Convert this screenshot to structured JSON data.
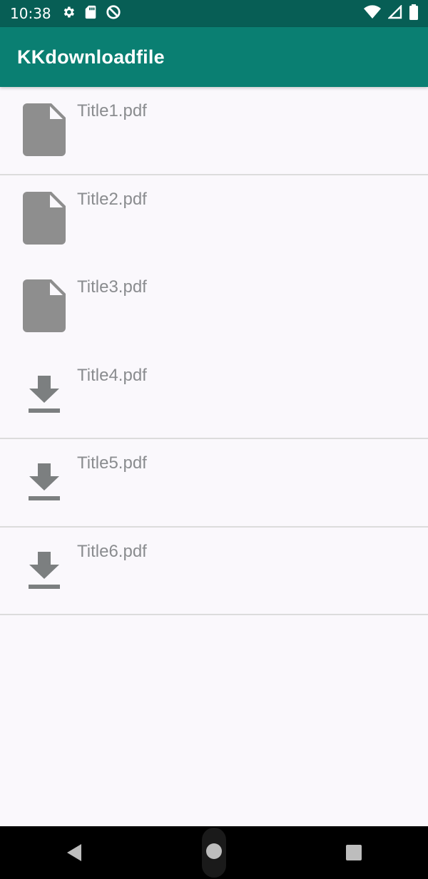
{
  "status_bar": {
    "time": "10:38",
    "left_icons": [
      "gear-icon",
      "sd-card-icon",
      "do-not-disturb-icon"
    ],
    "right_icons": [
      "wifi-icon",
      "signal-icon",
      "battery-icon"
    ]
  },
  "app_bar": {
    "title": "KKdownloadfile"
  },
  "files": [
    {
      "title": "Title1.pdf",
      "icon": "file-icon"
    },
    {
      "title": "Title2.pdf",
      "icon": "file-icon"
    },
    {
      "title": "Title3.pdf",
      "icon": "file-icon"
    },
    {
      "title": "Title4.pdf",
      "icon": "download-icon"
    },
    {
      "title": "Title5.pdf",
      "icon": "download-icon"
    },
    {
      "title": "Title6.pdf",
      "icon": "download-icon"
    }
  ],
  "nav_bar": {
    "buttons": [
      "back-icon",
      "home-icon",
      "recents-icon"
    ]
  },
  "colors": {
    "status_bar": "#075e55",
    "app_bar": "#0a7f72",
    "icon_gray": "#8e8e8e",
    "text_gray": "#8a8c8f"
  }
}
